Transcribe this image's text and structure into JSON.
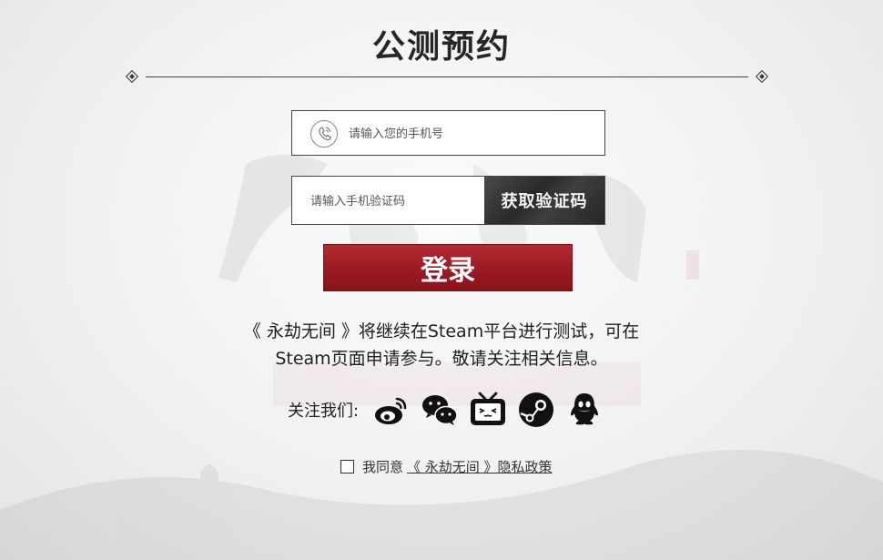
{
  "header": {
    "title": "公测预约"
  },
  "form": {
    "phone_placeholder": "请输入您的手机号",
    "code_placeholder": "请输入手机验证码",
    "get_code_label": "获取验证码",
    "login_label": "登录"
  },
  "notice": {
    "line1": "《 永劫无间 》将继续在Steam平台进行测试，可在",
    "line2": "Steam页面申请参与。敬请关注相关信息。"
  },
  "follow": {
    "label": "关注我们:",
    "icons": [
      "weibo-icon",
      "wechat-icon",
      "bilibili-icon",
      "steam-icon",
      "qq-icon"
    ]
  },
  "agreement": {
    "prefix": "我同意",
    "link_text": "《 永劫无间 》隐私政策"
  },
  "colors": {
    "accent_red": "#9c1b23",
    "dark_button": "#333333"
  }
}
